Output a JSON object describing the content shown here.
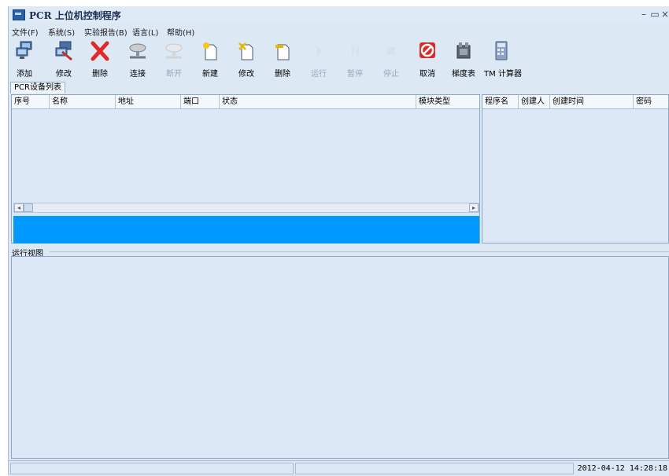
{
  "window": {
    "title": "PCR 上位机控制程序",
    "minimize": "–",
    "maximize": "▭",
    "close": "×"
  },
  "menu": [
    "文件(F)",
    "系统(S)",
    "实验报告(B)",
    "语言(L)",
    "帮助(H)"
  ],
  "toolbar": [
    {
      "label": "添加",
      "icon": "add-device-icon",
      "enabled": true
    },
    {
      "label": "修改",
      "icon": "edit-device-icon",
      "enabled": true
    },
    {
      "label": "删除",
      "icon": "delete-x-icon",
      "enabled": true
    },
    {
      "label": "连接",
      "icon": "connect-icon",
      "enabled": true
    },
    {
      "label": "断开",
      "icon": "disconnect-icon",
      "enabled": false
    },
    {
      "label": "新建",
      "icon": "new-file-icon",
      "enabled": true
    },
    {
      "label": "修改",
      "icon": "edit-file-icon",
      "enabled": true
    },
    {
      "label": "删除",
      "icon": "delete-file-icon",
      "enabled": true
    },
    {
      "label": "运行",
      "icon": "play-icon",
      "enabled": false
    },
    {
      "label": "暂停",
      "icon": "pause-icon",
      "enabled": false
    },
    {
      "label": "停止",
      "icon": "stop-icon",
      "enabled": false
    },
    {
      "label": "取消",
      "icon": "cancel-icon",
      "enabled": true
    },
    {
      "label": "梯度表",
      "icon": "gradient-table-icon",
      "enabled": true
    },
    {
      "label": "TM 计算器",
      "icon": "calculator-icon",
      "enabled": true
    }
  ],
  "device_tab": "PCR设备列表",
  "device_columns": [
    "序号",
    "名称",
    "地址",
    "端口",
    "状态",
    "模块类型"
  ],
  "program_columns": [
    "程序名",
    "创建人",
    "创建时间",
    "密码"
  ],
  "run_view_label": "运行视图",
  "status": {
    "datetime": "2012-04-12 14:28:18"
  },
  "colors": {
    "accent_blue": "#0099ff",
    "window_bg": "#dde8f5"
  }
}
